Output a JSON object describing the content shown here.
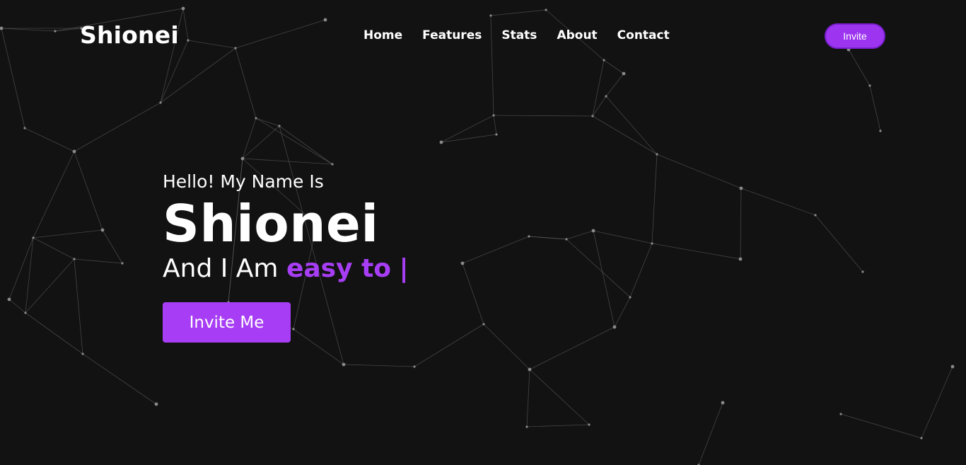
{
  "header": {
    "brand": "Shionei",
    "nav": [
      "Home",
      "Features",
      "Stats",
      "About",
      "Contact"
    ],
    "invite_label": "Invite"
  },
  "hero": {
    "greeting": "Hello! My Name Is",
    "name": "Shionei",
    "tagline_prefix": "And I Am",
    "tagline_typed": "easy to",
    "cursor": "|",
    "cta_label": "Invite Me"
  },
  "colors": {
    "background": "#121212",
    "accent": "#a73ef5"
  }
}
